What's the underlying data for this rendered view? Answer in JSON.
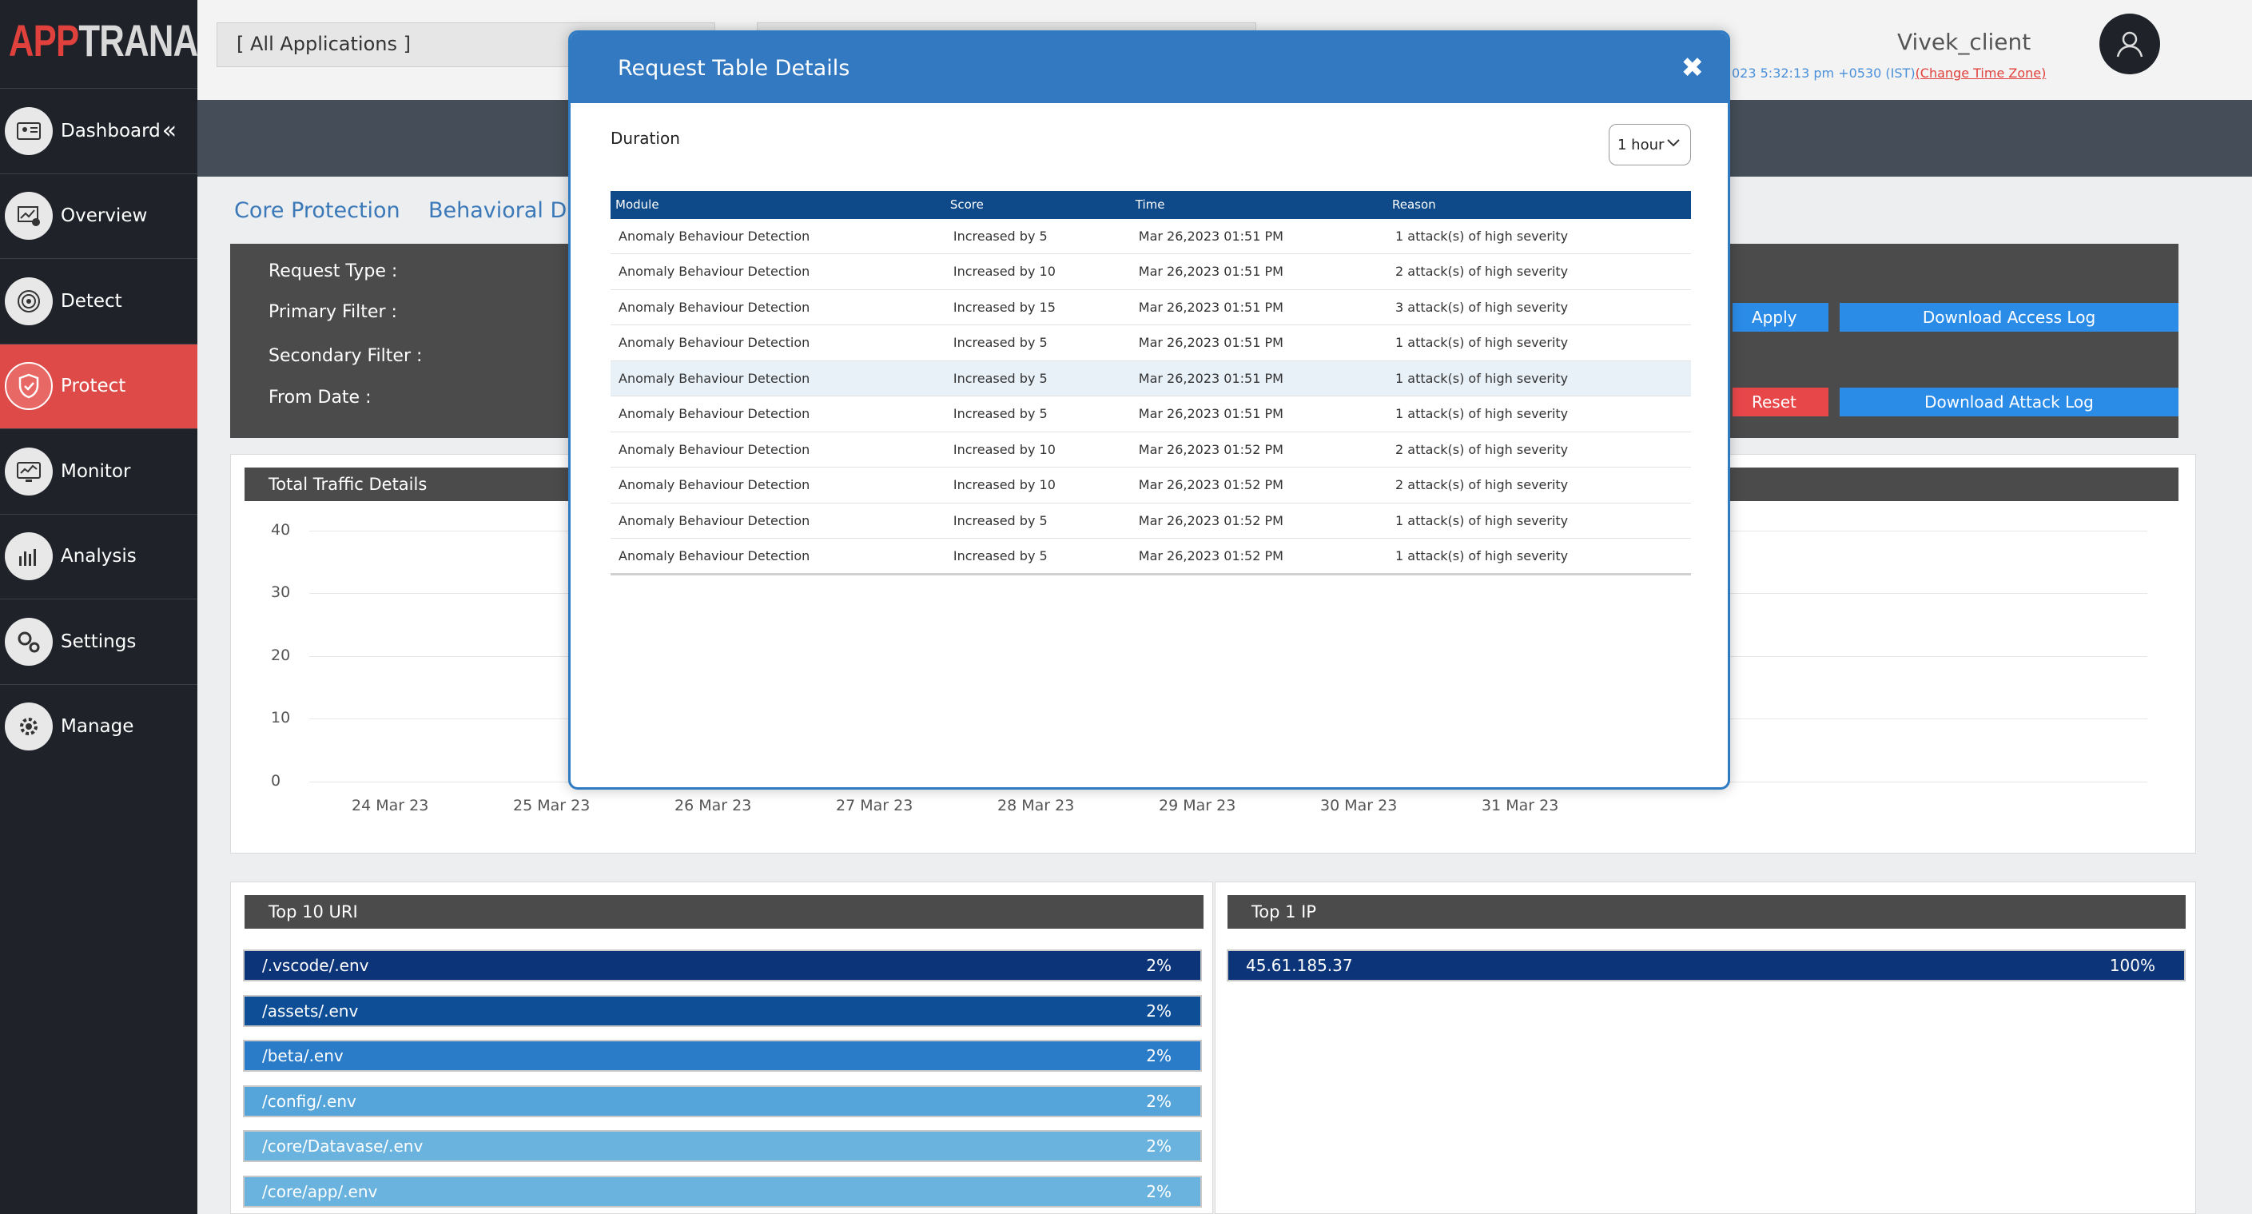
{
  "logo": {
    "part1": "APP",
    "part2": "TRANA"
  },
  "sidebar": {
    "items": [
      {
        "label": "Dashboard",
        "icon": "dashboard-icon"
      },
      {
        "label": "Overview",
        "icon": "overview-icon"
      },
      {
        "label": "Detect",
        "icon": "detect-icon"
      },
      {
        "label": "Protect",
        "icon": "shield-icon",
        "active": true
      },
      {
        "label": "Monitor",
        "icon": "monitor-icon"
      },
      {
        "label": "Analysis",
        "icon": "analysis-icon"
      },
      {
        "label": "Settings",
        "icon": "gears-icon"
      },
      {
        "label": "Manage",
        "icon": "gear-icon"
      }
    ],
    "collapse_glyph": "«"
  },
  "header": {
    "app_select": "[ All Applications ]",
    "username": "Vivek_client",
    "time_text": "023 5:32:13 pm +0530 (IST)",
    "change_tz": "(Change Time Zone)"
  },
  "tabs": [
    "Core Protection",
    "Behavioral DDo"
  ],
  "filters": {
    "request_type": "Request Type :",
    "primary": "Primary Filter :",
    "secondary": "Secondary Filter :",
    "from_date": "From Date :",
    "apply": "Apply",
    "reset": "Reset",
    "download_access": "Download Access Log",
    "download_attack": "Download Attack Log"
  },
  "traffic": {
    "title": "Total Traffic Details",
    "y_ticks": [
      "40",
      "30",
      "20",
      "10",
      "0"
    ],
    "x_ticks": [
      "24 Mar 23",
      "25 Mar 23",
      "26 Mar 23",
      "27 Mar 23",
      "28 Mar 23",
      "29 Mar 23",
      "30 Mar 23",
      "31 Mar 23"
    ]
  },
  "top_uri": {
    "title": "Top 10 URI",
    "rows": [
      {
        "label": "/.vscode/.env",
        "pct": "2%",
        "color": "#0b3578"
      },
      {
        "label": "/assets/.env",
        "pct": "2%",
        "color": "#0d4e96"
      },
      {
        "label": "/beta/.env",
        "pct": "2%",
        "color": "#2a7bc8"
      },
      {
        "label": "/config/.env",
        "pct": "2%",
        "color": "#56a5da"
      },
      {
        "label": "/core/Datavase/.env",
        "pct": "2%",
        "color": "#6ab3de"
      },
      {
        "label": "/core/app/.env",
        "pct": "2%",
        "color": "#6ab3de"
      }
    ]
  },
  "top_ip": {
    "title": "Top 1 IP",
    "rows": [
      {
        "label": "45.61.185.37",
        "pct": "100%",
        "color": "#0b3578"
      }
    ]
  },
  "modal": {
    "title": "Request Table Details",
    "close_glyph": "✖",
    "duration_label": "Duration",
    "duration_value": "1 hour",
    "columns": [
      "Module",
      "Score",
      "Time",
      "Reason"
    ],
    "rows": [
      [
        "Anomaly Behaviour Detection",
        "Increased by 5",
        "Mar 26,2023 01:51 PM",
        "1 attack(s) of high severity"
      ],
      [
        "Anomaly Behaviour Detection",
        "Increased by 10",
        "Mar 26,2023 01:51 PM",
        "2 attack(s) of high severity"
      ],
      [
        "Anomaly Behaviour Detection",
        "Increased by 15",
        "Mar 26,2023 01:51 PM",
        "3 attack(s) of high severity"
      ],
      [
        "Anomaly Behaviour Detection",
        "Increased by 5",
        "Mar 26,2023 01:51 PM",
        "1 attack(s) of high severity"
      ],
      [
        "Anomaly Behaviour Detection",
        "Increased by 5",
        "Mar 26,2023 01:51 PM",
        "1 attack(s) of high severity"
      ],
      [
        "Anomaly Behaviour Detection",
        "Increased by 5",
        "Mar 26,2023 01:51 PM",
        "1 attack(s) of high severity"
      ],
      [
        "Anomaly Behaviour Detection",
        "Increased by 10",
        "Mar 26,2023 01:52 PM",
        "2 attack(s) of high severity"
      ],
      [
        "Anomaly Behaviour Detection",
        "Increased by 10",
        "Mar 26,2023 01:52 PM",
        "2 attack(s) of high severity"
      ],
      [
        "Anomaly Behaviour Detection",
        "Increased by 5",
        "Mar 26,2023 01:52 PM",
        "1 attack(s) of high severity"
      ],
      [
        "Anomaly Behaviour Detection",
        "Increased by 5",
        "Mar 26,2023 01:52 PM",
        "1 attack(s) of high severity"
      ]
    ]
  }
}
